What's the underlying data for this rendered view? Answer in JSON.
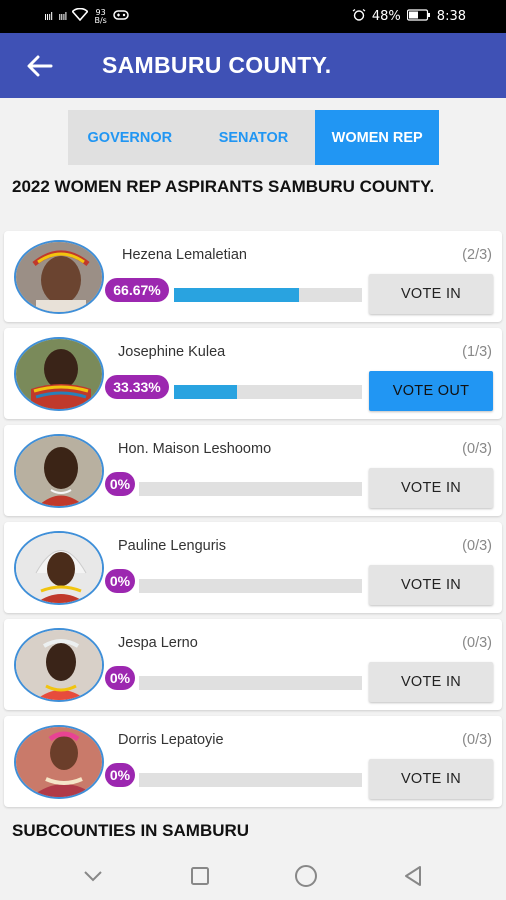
{
  "status_bar": {
    "signal_left": "ıııl",
    "signal_right": "ıııl",
    "data_speed_top": "93",
    "data_speed_bottom": "B/s",
    "battery": "48%",
    "time": "8:38"
  },
  "app_bar": {
    "title": "SAMBURU COUNTY."
  },
  "tabs": [
    {
      "label": "GOVERNOR",
      "active": false
    },
    {
      "label": "SENATOR",
      "active": false
    },
    {
      "label": "WOMEN REP",
      "active": true
    }
  ],
  "heading": "2022 WOMEN REP ASPIRANTS SAMBURU COUNTY.",
  "aspirants": [
    {
      "name": "Hezena Lemaletian",
      "votes": "(2/3)",
      "percent_label": "66.67%",
      "percent": 66.67,
      "button": "VOTE IN"
    },
    {
      "name": "Josephine Kulea",
      "votes": "(1/3)",
      "percent_label": "33.33%",
      "percent": 33.33,
      "button": "VOTE OUT"
    },
    {
      "name": "Hon. Maison Leshoomo",
      "votes": "(0/3)",
      "percent_label": "0%",
      "percent": 0,
      "button": "VOTE IN"
    },
    {
      "name": "Pauline Lenguris",
      "votes": "(0/3)",
      "percent_label": "0%",
      "percent": 0,
      "button": "VOTE IN"
    },
    {
      "name": "Jespa Lerno",
      "votes": "(0/3)",
      "percent_label": "0%",
      "percent": 0,
      "button": "VOTE IN"
    },
    {
      "name": "Dorris Lepatoyie",
      "votes": "(0/3)",
      "percent_label": "0%",
      "percent": 0,
      "button": "VOTE IN"
    }
  ],
  "subheading": "SUBCOUNTIES IN SAMBURU",
  "colors": {
    "app_bar": "#3f51b5",
    "accent": "#2196f3",
    "badge": "#9c27b0",
    "progress": "#29a3e0"
  }
}
